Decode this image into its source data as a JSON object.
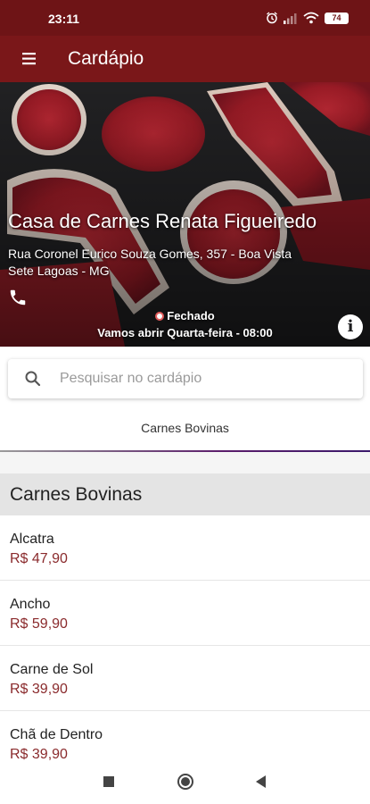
{
  "status_bar": {
    "time": "23:11",
    "battery": "74"
  },
  "app_bar": {
    "title": "Cardápio"
  },
  "store": {
    "name": "Casa de Carnes Renata Figueiredo",
    "address_line1": "Rua Coronel Eurico Souza Gomes, 357 - Boa Vista",
    "address_line2": "Sete Lagoas - MG",
    "status": "Fechado",
    "reopen": "Vamos abrir Quarta-feira - 08:00"
  },
  "search": {
    "placeholder": "Pesquisar no cardápio"
  },
  "tabs": [
    {
      "label": "Carnes Bovinas"
    }
  ],
  "section": {
    "title": "Carnes Bovinas"
  },
  "items": [
    {
      "name": "Alcatra",
      "price": "R$ 47,90"
    },
    {
      "name": "Ancho",
      "price": "R$ 59,90"
    },
    {
      "name": "Carne de Sol",
      "price": "R$ 39,90"
    },
    {
      "name": "Chã de Dentro",
      "price": "R$ 39,90"
    }
  ],
  "colors": {
    "status_bar": "#6e1416",
    "app_bar": "#7a1719",
    "price": "#8a2a2c",
    "section_header": "#e4e4e4"
  },
  "icons": {
    "menu": "menu-icon",
    "phone": "phone-icon",
    "info": "info-icon",
    "search": "search-icon",
    "alarm": "alarm-icon",
    "signal": "signal-icon",
    "wifi": "wifi-icon",
    "battery": "battery-icon"
  }
}
